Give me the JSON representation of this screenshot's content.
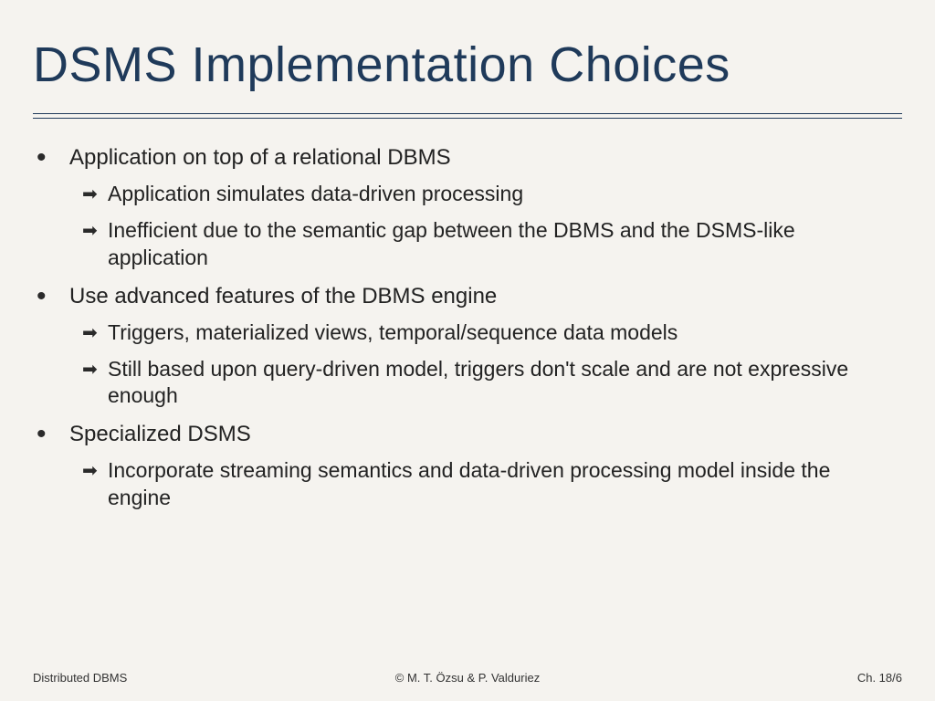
{
  "title": "DSMS Implementation Choices",
  "bullets": [
    {
      "text": "Application on top of a relational DBMS",
      "subs": [
        "Application simulates data-driven processing",
        "Inefficient due to the semantic gap between the DBMS and the DSMS-like application"
      ]
    },
    {
      "text": "Use advanced features of the DBMS engine",
      "subs": [
        "Triggers, materialized views, temporal/sequence data models",
        "Still based upon query-driven model, triggers don't scale and are not expressive enough"
      ]
    },
    {
      "text": "Specialized DSMS",
      "subs": [
        "Incorporate streaming semantics and data-driven processing model inside the engine"
      ]
    }
  ],
  "footer": {
    "left": "Distributed DBMS",
    "center": "© M. T. Özsu & P. Valduriez",
    "right": "Ch. 18/6"
  }
}
